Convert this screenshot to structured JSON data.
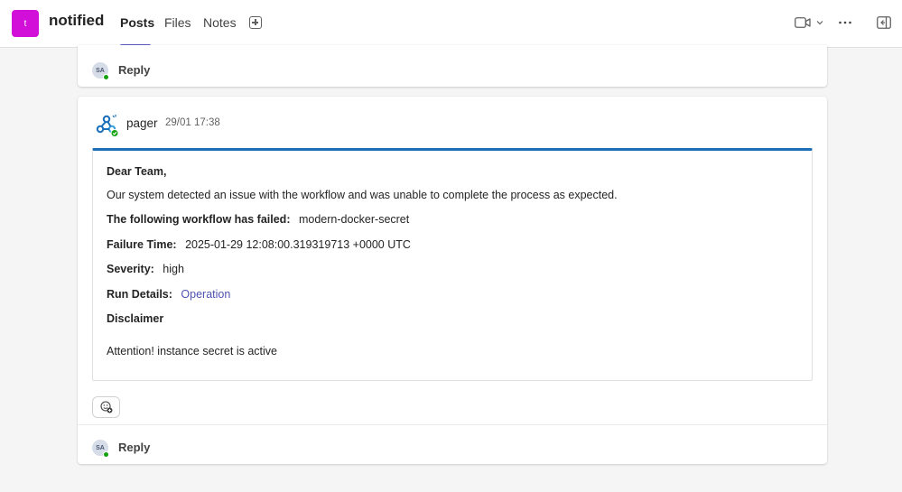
{
  "header": {
    "team_avatar_letter": "t",
    "team_name": "notified",
    "tabs": [
      {
        "label": "Posts",
        "active": true
      },
      {
        "label": "Files",
        "active": false
      },
      {
        "label": "Notes",
        "active": false
      }
    ],
    "icons": [
      "add-tab-icon",
      "video-icon",
      "chevron-down-icon",
      "more-icon",
      "open-panel-icon"
    ],
    "accent": "#5b5fc7",
    "team_color": "#d20fd8"
  },
  "thread_top": {
    "reply_avatar": "SA",
    "reply_label": "Reply"
  },
  "message": {
    "sender": "pager",
    "timestamp": "29/01 17:38",
    "card": {
      "greeting": "Dear Team,",
      "intro": "Our system detected an issue with the workflow and was unable to complete the process as expected.",
      "failed_label": "The following workflow has failed:",
      "failed_value": "modern-docker-secret",
      "failure_time_label": "Failure Time:",
      "failure_time_value": "2025-01-29 12:08:00.319319713 +0000 UTC",
      "severity_label": "Severity:",
      "severity_value": "high",
      "run_details_label": "Run Details:",
      "run_details_link": "Operation",
      "disclaimer_heading": "Disclaimer",
      "disclaimer_text": "Attention! instance secret is active",
      "accent": "#1a6fb8"
    },
    "reaction_icon": "add-reaction-icon",
    "reply_avatar": "SA",
    "reply_label": "Reply"
  }
}
